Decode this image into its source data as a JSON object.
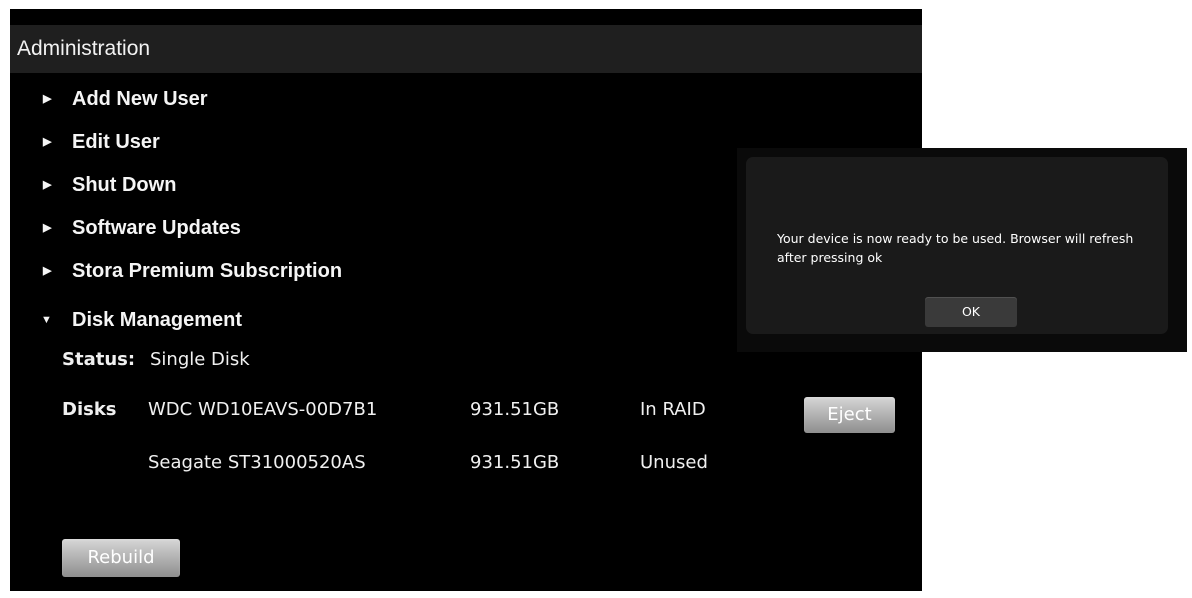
{
  "header": {
    "title": "Administration"
  },
  "menu": {
    "items": [
      {
        "label": "Add New User",
        "expanded": false
      },
      {
        "label": "Edit User",
        "expanded": false
      },
      {
        "label": "Shut Down",
        "expanded": false
      },
      {
        "label": "Software Updates",
        "expanded": false
      },
      {
        "label": "Stora Premium Subscription",
        "expanded": false
      },
      {
        "label": "Disk Management",
        "expanded": true
      }
    ]
  },
  "disk_management": {
    "status_label": "Status:",
    "status_value": "Single Disk",
    "disks_label": "Disks",
    "disks": [
      {
        "name": "WDC WD10EAVS-00D7B1",
        "size": "931.51GB",
        "state": "In RAID",
        "action": "Eject"
      },
      {
        "name": "Seagate ST31000520AS",
        "size": "931.51GB",
        "state": "Unused",
        "action": ""
      }
    ],
    "rebuild_label": "Rebuild"
  },
  "dialog": {
    "message": "Your device is now ready to be used.  Browser will refresh after pressing ok",
    "ok_label": "OK"
  },
  "colors": {
    "panel_bg": "#000000",
    "header_bg": "#1f1f1f",
    "dialog_bg": "#1a1a1a",
    "button_gradient_top": "#d6d6d6",
    "button_gradient_bottom": "#8e8e8e"
  }
}
